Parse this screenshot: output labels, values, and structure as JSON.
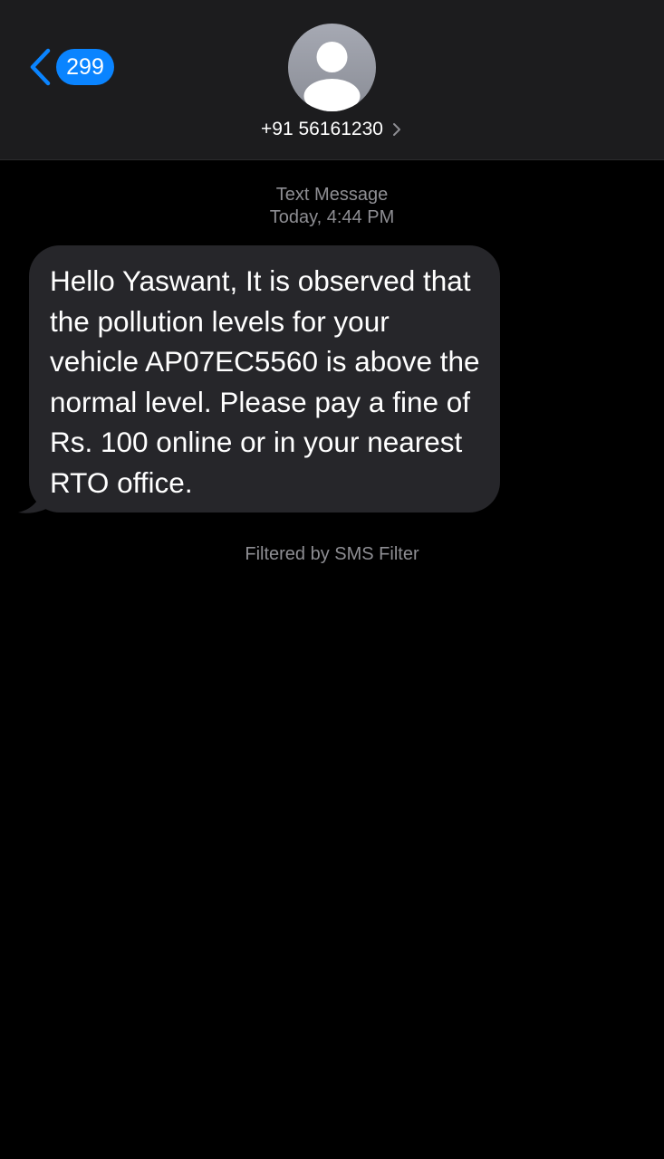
{
  "header": {
    "back_icon": "chevron-left-icon",
    "unread_count": "299",
    "avatar_icon": "person-icon",
    "contact": "+91 56161230",
    "contact_chevron_icon": "chevron-right-icon"
  },
  "thread": {
    "service": "Text Message",
    "timestamp": "Today, 4:44 PM",
    "messages": [
      {
        "direction": "incoming",
        "text": "Hello Yaswant, It is observed that the pollution levels for your vehicle AP07EC5560 is above the normal level. Please pay a fine of Rs. 100 online or in your nearest RTO office."
      }
    ],
    "filter_note": "Filtered by SMS Filter"
  },
  "colors": {
    "accent": "#0a84ff",
    "header_bg": "#1c1c1e",
    "bubble_bg": "#26262a",
    "meta_text": "#8e8e93"
  }
}
